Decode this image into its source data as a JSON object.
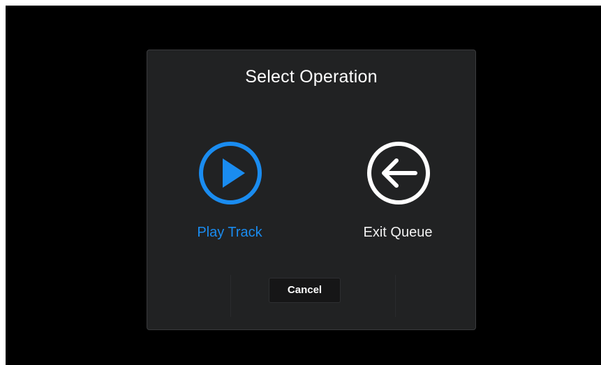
{
  "dialog": {
    "title": "Select Operation",
    "options": [
      {
        "label": "Play Track",
        "icon": "play-circle-icon",
        "state": "focused",
        "color": "#1a8cf0"
      },
      {
        "label": "Exit Queue",
        "icon": "back-arrow-circle-icon",
        "state": "normal",
        "color": "#ffffff"
      }
    ],
    "cancel_label": "Cancel"
  },
  "colors": {
    "screen_background": "#000000",
    "dialog_background": "#212223",
    "accent": "#1a8cf0",
    "text": "#ffffff"
  }
}
